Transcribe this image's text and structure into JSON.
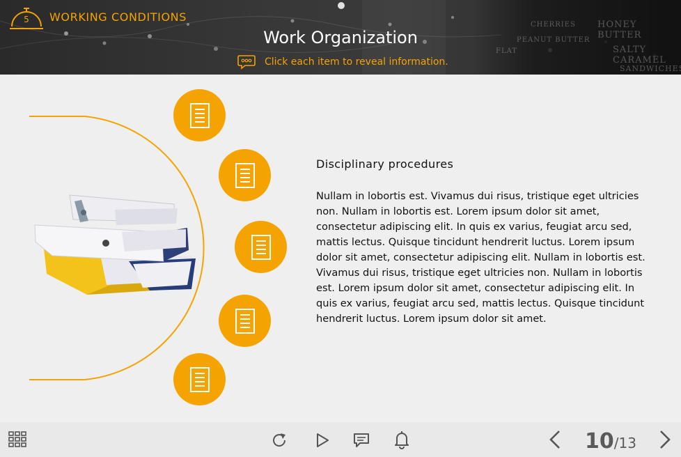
{
  "header": {
    "module_number": "5",
    "module_label": "WORKING CONDITIONS",
    "title": "Work Organization",
    "instruction": "Click each item to reveal information.",
    "board_text": [
      "HONEY BUTTER",
      "SALTY CARAMEL",
      "SANDWICHES",
      "CHERRIES",
      "PEANUT BUTTER",
      "FLAT"
    ],
    "accent_color": "#f5a300"
  },
  "items": [
    {
      "icon": "document-icon"
    },
    {
      "icon": "document-icon"
    },
    {
      "icon": "document-icon"
    },
    {
      "icon": "document-icon"
    },
    {
      "icon": "document-icon"
    }
  ],
  "content": {
    "heading": "Disciplinary procedures",
    "body": "Nullam in lobortis est. Vivamus dui risus, tristique eget ultricies non. Nullam in lobortis est. Lorem ipsum dolor sit amet, consectetur adipiscing elit. In quis ex varius, feugiat arcu sed, mattis lectus. Quisque tincidunt hendrerit luctus. Lorem ipsum dolor sit amet, consectetur adipiscing elit. Nullam in lobortis est. Vivamus dui risus, tristique eget ultricies non. Nullam in lobortis est. Lorem ipsum dolor sit amet, consectetur adipiscing elit. In quis ex varius, feugiat arcu sed, mattis lectus. Quisque tincidunt hendrerit luctus. Lorem ipsum dolor sit amet."
  },
  "footer": {
    "current_page": "10",
    "total_pages": "/13",
    "icons": [
      "grid-menu-icon",
      "replay-icon",
      "play-icon",
      "comment-icon",
      "bell-icon",
      "chevron-left-icon",
      "chevron-right-icon"
    ]
  }
}
